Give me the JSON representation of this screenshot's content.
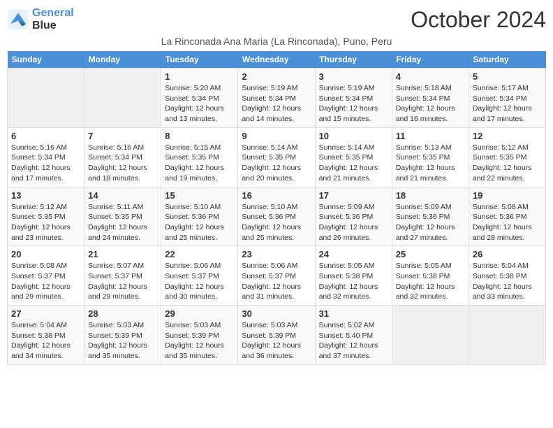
{
  "header": {
    "logo_line1": "General",
    "logo_line2": "Blue",
    "month_title": "October 2024",
    "subtitle": "La Rinconada Ana Maria (La Rinconada), Puno, Peru"
  },
  "weekdays": [
    "Sunday",
    "Monday",
    "Tuesday",
    "Wednesday",
    "Thursday",
    "Friday",
    "Saturday"
  ],
  "weeks": [
    [
      {
        "day": "",
        "info": ""
      },
      {
        "day": "",
        "info": ""
      },
      {
        "day": "1",
        "info": "Sunrise: 5:20 AM\nSunset: 5:34 PM\nDaylight: 12 hours and 13 minutes."
      },
      {
        "day": "2",
        "info": "Sunrise: 5:19 AM\nSunset: 5:34 PM\nDaylight: 12 hours and 14 minutes."
      },
      {
        "day": "3",
        "info": "Sunrise: 5:19 AM\nSunset: 5:34 PM\nDaylight: 12 hours and 15 minutes."
      },
      {
        "day": "4",
        "info": "Sunrise: 5:18 AM\nSunset: 5:34 PM\nDaylight: 12 hours and 16 minutes."
      },
      {
        "day": "5",
        "info": "Sunrise: 5:17 AM\nSunset: 5:34 PM\nDaylight: 12 hours and 17 minutes."
      }
    ],
    [
      {
        "day": "6",
        "info": "Sunrise: 5:16 AM\nSunset: 5:34 PM\nDaylight: 12 hours and 17 minutes."
      },
      {
        "day": "7",
        "info": "Sunrise: 5:16 AM\nSunset: 5:34 PM\nDaylight: 12 hours and 18 minutes."
      },
      {
        "day": "8",
        "info": "Sunrise: 5:15 AM\nSunset: 5:35 PM\nDaylight: 12 hours and 19 minutes."
      },
      {
        "day": "9",
        "info": "Sunrise: 5:14 AM\nSunset: 5:35 PM\nDaylight: 12 hours and 20 minutes."
      },
      {
        "day": "10",
        "info": "Sunrise: 5:14 AM\nSunset: 5:35 PM\nDaylight: 12 hours and 21 minutes."
      },
      {
        "day": "11",
        "info": "Sunrise: 5:13 AM\nSunset: 5:35 PM\nDaylight: 12 hours and 21 minutes."
      },
      {
        "day": "12",
        "info": "Sunrise: 5:12 AM\nSunset: 5:35 PM\nDaylight: 12 hours and 22 minutes."
      }
    ],
    [
      {
        "day": "13",
        "info": "Sunrise: 5:12 AM\nSunset: 5:35 PM\nDaylight: 12 hours and 23 minutes."
      },
      {
        "day": "14",
        "info": "Sunrise: 5:11 AM\nSunset: 5:35 PM\nDaylight: 12 hours and 24 minutes."
      },
      {
        "day": "15",
        "info": "Sunrise: 5:10 AM\nSunset: 5:36 PM\nDaylight: 12 hours and 25 minutes."
      },
      {
        "day": "16",
        "info": "Sunrise: 5:10 AM\nSunset: 5:36 PM\nDaylight: 12 hours and 25 minutes."
      },
      {
        "day": "17",
        "info": "Sunrise: 5:09 AM\nSunset: 5:36 PM\nDaylight: 12 hours and 26 minutes."
      },
      {
        "day": "18",
        "info": "Sunrise: 5:09 AM\nSunset: 5:36 PM\nDaylight: 12 hours and 27 minutes."
      },
      {
        "day": "19",
        "info": "Sunrise: 5:08 AM\nSunset: 5:36 PM\nDaylight: 12 hours and 28 minutes."
      }
    ],
    [
      {
        "day": "20",
        "info": "Sunrise: 5:08 AM\nSunset: 5:37 PM\nDaylight: 12 hours and 29 minutes."
      },
      {
        "day": "21",
        "info": "Sunrise: 5:07 AM\nSunset: 5:37 PM\nDaylight: 12 hours and 29 minutes."
      },
      {
        "day": "22",
        "info": "Sunrise: 5:06 AM\nSunset: 5:37 PM\nDaylight: 12 hours and 30 minutes."
      },
      {
        "day": "23",
        "info": "Sunrise: 5:06 AM\nSunset: 5:37 PM\nDaylight: 12 hours and 31 minutes."
      },
      {
        "day": "24",
        "info": "Sunrise: 5:05 AM\nSunset: 5:38 PM\nDaylight: 12 hours and 32 minutes."
      },
      {
        "day": "25",
        "info": "Sunrise: 5:05 AM\nSunset: 5:38 PM\nDaylight: 12 hours and 32 minutes."
      },
      {
        "day": "26",
        "info": "Sunrise: 5:04 AM\nSunset: 5:38 PM\nDaylight: 12 hours and 33 minutes."
      }
    ],
    [
      {
        "day": "27",
        "info": "Sunrise: 5:04 AM\nSunset: 5:38 PM\nDaylight: 12 hours and 34 minutes."
      },
      {
        "day": "28",
        "info": "Sunrise: 5:03 AM\nSunset: 5:39 PM\nDaylight: 12 hours and 35 minutes."
      },
      {
        "day": "29",
        "info": "Sunrise: 5:03 AM\nSunset: 5:39 PM\nDaylight: 12 hours and 35 minutes."
      },
      {
        "day": "30",
        "info": "Sunrise: 5:03 AM\nSunset: 5:39 PM\nDaylight: 12 hours and 36 minutes."
      },
      {
        "day": "31",
        "info": "Sunrise: 5:02 AM\nSunset: 5:40 PM\nDaylight: 12 hours and 37 minutes."
      },
      {
        "day": "",
        "info": ""
      },
      {
        "day": "",
        "info": ""
      }
    ]
  ]
}
